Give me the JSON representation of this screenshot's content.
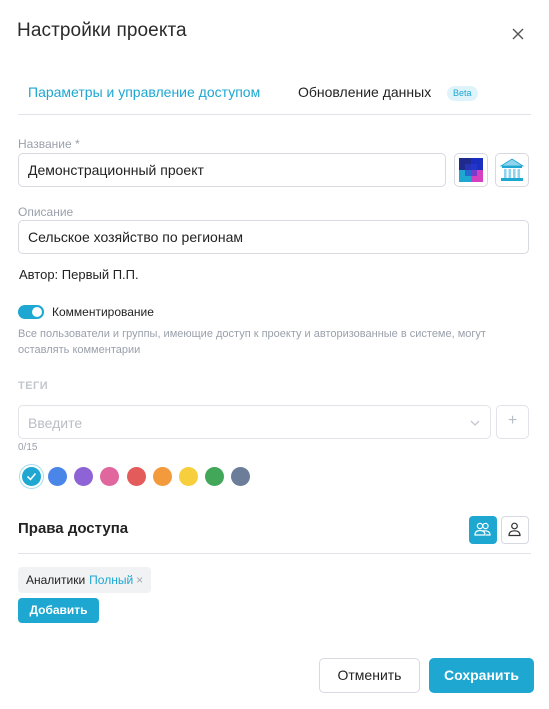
{
  "dialog": {
    "title": "Настройки проекта",
    "close_icon": "close-icon"
  },
  "tabs": [
    {
      "label": "Параметры и управление доступом",
      "active": true
    },
    {
      "label": "Обновление данных",
      "active": false,
      "badge": "Beta"
    }
  ],
  "name_field": {
    "label": "Название *",
    "value": "Демонстрационный проект",
    "icon_buttons": [
      "palette-icon",
      "museum-icon"
    ]
  },
  "description_field": {
    "label": "Описание",
    "value": "Сельское хозяйство по регионам"
  },
  "author": {
    "text": "Автор: Первый П.П."
  },
  "commenting": {
    "label": "Комментирование",
    "enabled": true,
    "hint": "Все пользователи и группы, имеющие доступ к проекту и авторизованные в системе, могут оставлять комментарии"
  },
  "tags": {
    "title": "ТЕГИ",
    "placeholder": "Введите",
    "add_symbol": "+",
    "counter": "0/15",
    "colors": [
      "#1da7d1",
      "#4a86e8",
      "#8e63d6",
      "#e0679d",
      "#e35b5b",
      "#f29a3c",
      "#f7cf3c",
      "#43a75a",
      "#6b7d99"
    ],
    "selected_color_index": 0
  },
  "access": {
    "title": "Права доступа",
    "view_icons": [
      "group-icon",
      "user-icon"
    ],
    "chips": [
      {
        "name": "Аналитики",
        "role": "Полный",
        "remove": "×"
      }
    ],
    "add_label": "Добавить"
  },
  "footer": {
    "cancel_label": "Отменить",
    "save_label": "Сохранить"
  },
  "colors": {
    "accent": "#1da7d1",
    "muted_text": "#9aa0ab",
    "border": "#d6d9df"
  }
}
